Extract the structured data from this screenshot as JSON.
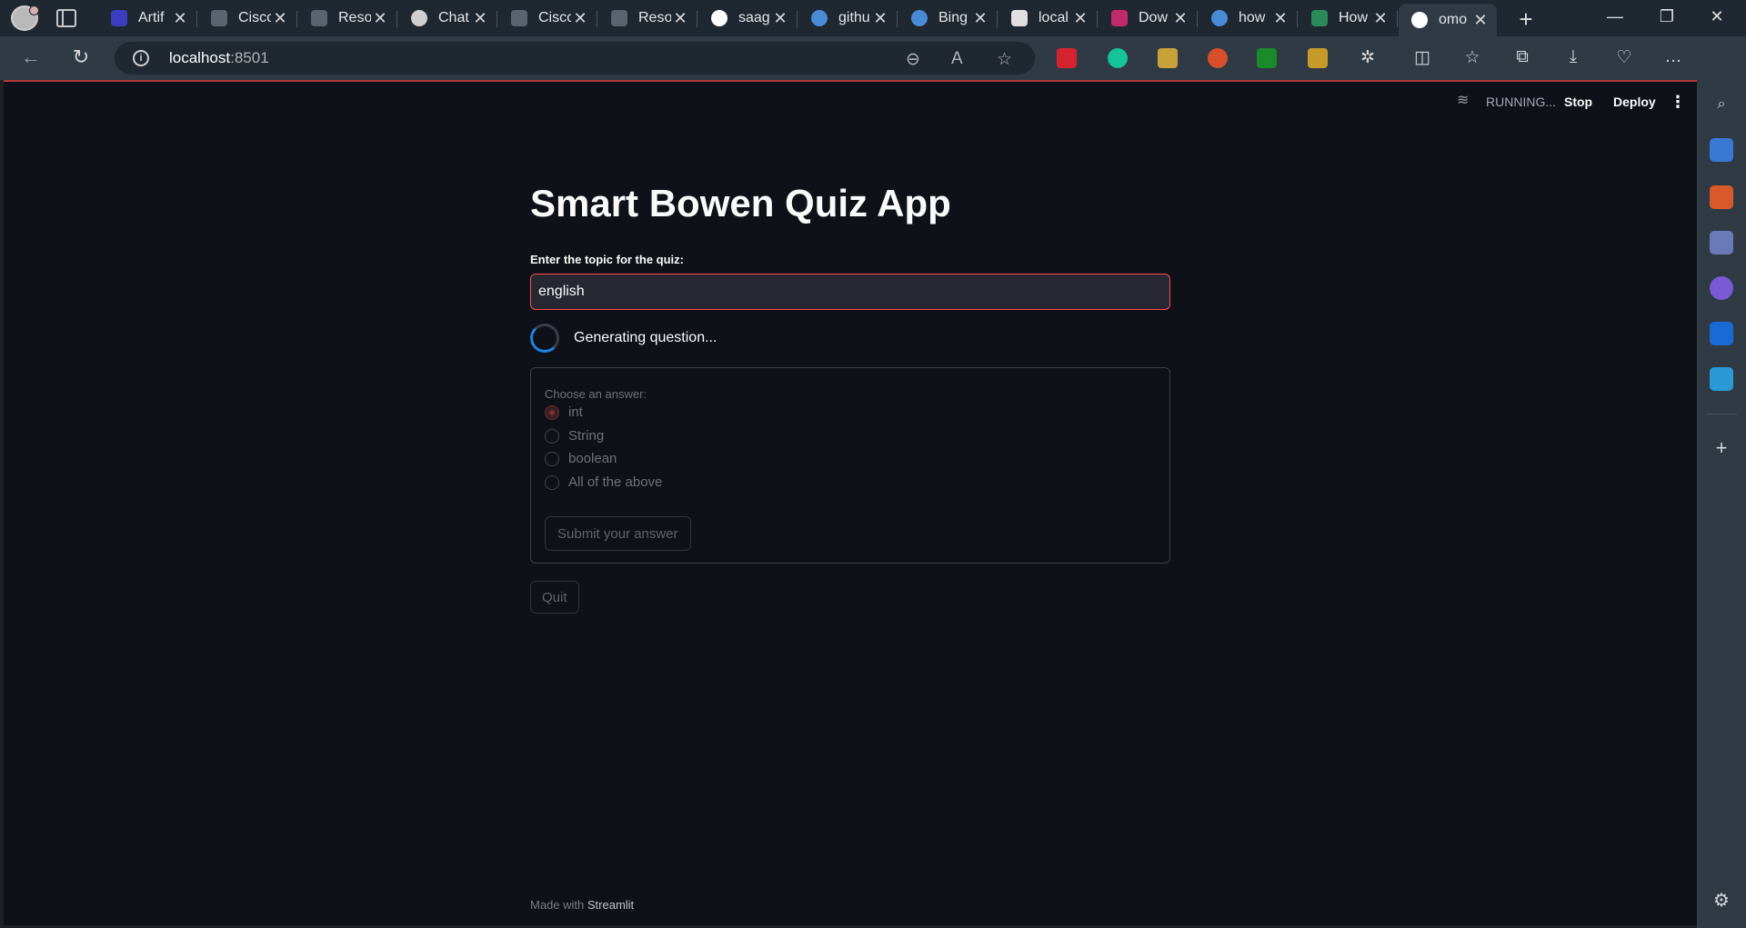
{
  "browser": {
    "tabs": [
      {
        "title": "Artif",
        "color": "#3b3fbf"
      },
      {
        "title": "Cisco",
        "color": "#5a6470"
      },
      {
        "title": "Reso",
        "color": "#5a6470"
      },
      {
        "title": "Chat",
        "color": "#cfcfcf"
      },
      {
        "title": "Cisco",
        "color": "#5a6470"
      },
      {
        "title": "Reso",
        "color": "#5a6470"
      },
      {
        "title": "saag",
        "color": "#ffffff"
      },
      {
        "title": "githu",
        "color": "#4a8bd6"
      },
      {
        "title": "Bing",
        "color": "#4a8bd6"
      },
      {
        "title": "local",
        "color": "#e0e0e0"
      },
      {
        "title": "Dow",
        "color": "#c02a6a"
      },
      {
        "title": "how",
        "color": "#4a8bd6"
      },
      {
        "title": "How",
        "color": "#2a8a5a"
      },
      {
        "title": "omo",
        "color": "#ffffff"
      }
    ],
    "address": {
      "host": "localhost",
      "port": ":8501"
    },
    "window_controls": {
      "minimize": "—",
      "restore": "❐",
      "close": "✕"
    }
  },
  "app_header": {
    "status": "RUNNING...",
    "stop_label": "Stop",
    "deploy_label": "Deploy",
    "menu_icon": "⋮"
  },
  "app": {
    "title": "Smart Bowen Quiz App",
    "topic_label": "Enter the topic for the quiz:",
    "topic_value": "english",
    "status_text": "Generating question...",
    "form": {
      "prompt": "Choose an answer:",
      "options": [
        "int",
        "String",
        "boolean",
        "All of the above"
      ],
      "selected_index": 0,
      "submit_label": "Submit your answer"
    },
    "quit_label": "Quit",
    "footer_prefix": "Made with",
    "footer_brand": "Streamlit"
  },
  "colors": {
    "page_bg": "#0e1117",
    "accent_red": "#ff4b4b",
    "spinner_blue": "#1c83e1"
  }
}
